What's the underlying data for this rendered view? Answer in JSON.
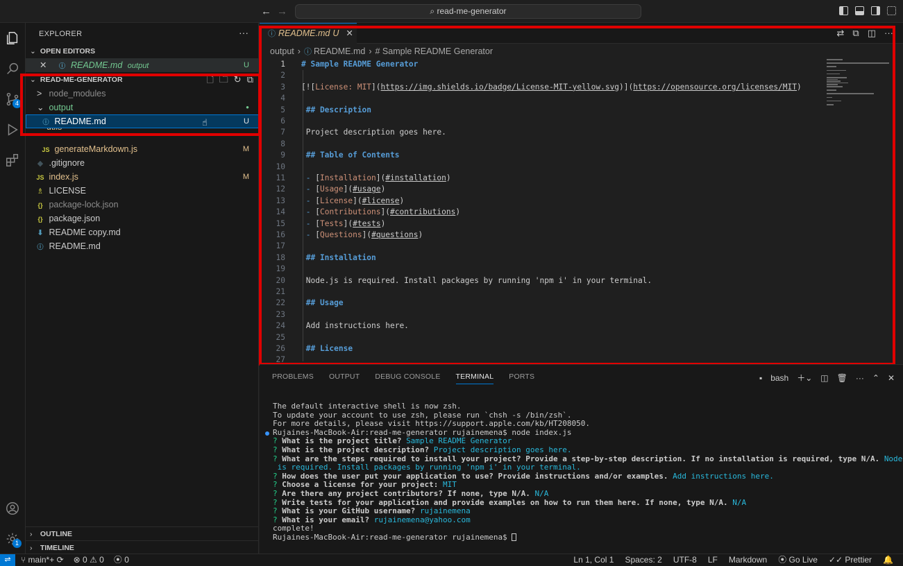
{
  "titlebar": {
    "back_icon": "arrow-left-icon",
    "forward_icon": "arrow-right-icon",
    "search_text": "read-me-generator"
  },
  "activity": {
    "scm_badge": "4",
    "settings_badge": "1"
  },
  "sidebar": {
    "title": "EXPLORER",
    "more": "···",
    "open_editors": {
      "header": "OPEN EDITORS",
      "items": [
        {
          "name": "README.md",
          "folder": "output",
          "status": "U"
        }
      ]
    },
    "project": {
      "header": "READ-ME-GENERATOR",
      "items": [
        {
          "label": "node_modules",
          "kind": "folder",
          "chevron": ">",
          "status": ""
        },
        {
          "label": "output",
          "kind": "folder",
          "chevron": "⌄",
          "status": "●"
        },
        {
          "label": "README.md",
          "kind": "info",
          "status": "U"
        },
        {
          "label": "utils",
          "kind": "folder",
          "status": ""
        },
        {
          "label": "generateMarkdown.js",
          "kind": "js",
          "status": "M"
        },
        {
          "label": ".gitignore",
          "kind": "git",
          "status": ""
        },
        {
          "label": "index.js",
          "kind": "js",
          "status": "M"
        },
        {
          "label": "LICENSE",
          "kind": "license",
          "status": ""
        },
        {
          "label": "package-lock.json",
          "kind": "json",
          "status": ""
        },
        {
          "label": "package.json",
          "kind": "json",
          "status": ""
        },
        {
          "label": "README copy.md",
          "kind": "md",
          "status": ""
        },
        {
          "label": "README.md",
          "kind": "md",
          "status": ""
        }
      ]
    },
    "outline": "OUTLINE",
    "timeline": "TIMELINE"
  },
  "editor": {
    "tab": {
      "label": "README.md",
      "status": "U",
      "close": "✕"
    },
    "breadcrumb": [
      "output",
      "README.md",
      "# Sample README Generator"
    ],
    "lines": [
      {
        "n": "1",
        "parts": [
          {
            "t": "# Sample README Generator",
            "c": "hd"
          }
        ]
      },
      {
        "n": "2",
        "parts": []
      },
      {
        "n": "3",
        "parts": [
          {
            "t": "[![",
            "c": "lt"
          },
          {
            "t": "License: MIT",
            "c": "lk"
          },
          {
            "t": "](",
            "c": "lt"
          },
          {
            "t": "https://img.shields.io/badge/License-MIT-yellow.svg",
            "c": "lu"
          },
          {
            "t": ")](",
            "c": "lt"
          },
          {
            "t": "https://opensource.org/licenses/MIT",
            "c": "lu"
          },
          {
            "t": ")",
            "c": "lt"
          }
        ]
      },
      {
        "n": "4",
        "parts": []
      },
      {
        "n": "5",
        "parts": [
          {
            "t": " ## Description",
            "c": "hd"
          }
        ]
      },
      {
        "n": "6",
        "parts": []
      },
      {
        "n": "7",
        "parts": [
          {
            "t": " Project description goes here.",
            "c": "lt"
          }
        ]
      },
      {
        "n": "8",
        "parts": []
      },
      {
        "n": "9",
        "parts": [
          {
            "t": " ## Table of Contents",
            "c": "hd"
          }
        ]
      },
      {
        "n": "10",
        "parts": []
      },
      {
        "n": "11",
        "parts": [
          {
            "t": " - ",
            "c": "ls"
          },
          {
            "t": "[",
            "c": "lt"
          },
          {
            "t": "Installation",
            "c": "lk"
          },
          {
            "t": "](",
            "c": "lt"
          },
          {
            "t": "#installation",
            "c": "lu"
          },
          {
            "t": ")",
            "c": "lt"
          }
        ]
      },
      {
        "n": "12",
        "parts": [
          {
            "t": " - ",
            "c": "ls"
          },
          {
            "t": "[",
            "c": "lt"
          },
          {
            "t": "Usage",
            "c": "lk"
          },
          {
            "t": "](",
            "c": "lt"
          },
          {
            "t": "#usage",
            "c": "lu"
          },
          {
            "t": ")",
            "c": "lt"
          }
        ]
      },
      {
        "n": "13",
        "parts": [
          {
            "t": " - ",
            "c": "ls"
          },
          {
            "t": "[",
            "c": "lt"
          },
          {
            "t": "License",
            "c": "lk"
          },
          {
            "t": "](",
            "c": "lt"
          },
          {
            "t": "#license",
            "c": "lu"
          },
          {
            "t": ")",
            "c": "lt"
          }
        ]
      },
      {
        "n": "14",
        "parts": [
          {
            "t": " - ",
            "c": "ls"
          },
          {
            "t": "[",
            "c": "lt"
          },
          {
            "t": "Contributions",
            "c": "lk"
          },
          {
            "t": "](",
            "c": "lt"
          },
          {
            "t": "#contributions",
            "c": "lu"
          },
          {
            "t": ")",
            "c": "lt"
          }
        ]
      },
      {
        "n": "15",
        "parts": [
          {
            "t": " - ",
            "c": "ls"
          },
          {
            "t": "[",
            "c": "lt"
          },
          {
            "t": "Tests",
            "c": "lk"
          },
          {
            "t": "](",
            "c": "lt"
          },
          {
            "t": "#tests",
            "c": "lu"
          },
          {
            "t": ")",
            "c": "lt"
          }
        ]
      },
      {
        "n": "16",
        "parts": [
          {
            "t": " - ",
            "c": "ls"
          },
          {
            "t": "[",
            "c": "lt"
          },
          {
            "t": "Questions",
            "c": "lk"
          },
          {
            "t": "](",
            "c": "lt"
          },
          {
            "t": "#questions",
            "c": "lu"
          },
          {
            "t": ")",
            "c": "lt"
          }
        ]
      },
      {
        "n": "17",
        "parts": []
      },
      {
        "n": "18",
        "parts": [
          {
            "t": " ## Installation",
            "c": "hd"
          }
        ]
      },
      {
        "n": "19",
        "parts": []
      },
      {
        "n": "20",
        "parts": [
          {
            "t": " Node.js is required. Install packages by running 'npm i' in your terminal.",
            "c": "lt"
          }
        ]
      },
      {
        "n": "21",
        "parts": []
      },
      {
        "n": "22",
        "parts": [
          {
            "t": " ## Usage",
            "c": "hd"
          }
        ]
      },
      {
        "n": "23",
        "parts": []
      },
      {
        "n": "24",
        "parts": [
          {
            "t": " Add instructions here.",
            "c": "lt"
          }
        ]
      },
      {
        "n": "25",
        "parts": []
      },
      {
        "n": "26",
        "parts": [
          {
            "t": " ## License",
            "c": "hd"
          }
        ]
      },
      {
        "n": "27",
        "parts": []
      }
    ]
  },
  "panel": {
    "tabs": [
      "PROBLEMS",
      "OUTPUT",
      "DEBUG CONSOLE",
      "TERMINAL",
      "PORTS"
    ],
    "active_tab": "TERMINAL",
    "shell": "bash",
    "terminal": [
      {
        "type": "plain",
        "text": "The default interactive shell is now zsh."
      },
      {
        "type": "plain",
        "text": "To update your account to use zsh, please run `chsh -s /bin/zsh`."
      },
      {
        "type": "plain",
        "text": "For more details, please visit https://support.apple.com/kb/HT208050."
      },
      {
        "type": "prompt",
        "text": "Rujaines-MacBook-Air:read-me-generator rujainemena$ node index.js"
      },
      {
        "type": "qa",
        "q": "What is the project title?",
        "a": "Sample README Generator"
      },
      {
        "type": "qa",
        "q": "What is the project description?",
        "a": "Project description goes here."
      },
      {
        "type": "qa",
        "q": "What are the steps required to install your project? Provide a step-by-step description. If no installation is required, type N/A.",
        "a": "Node.js"
      },
      {
        "type": "cont",
        "text": " is required. Install packages by running 'npm i' in your terminal."
      },
      {
        "type": "qa",
        "q": "How does the user put your application to use? Provide instructions and/or examples.",
        "a": "Add instructions here."
      },
      {
        "type": "qa",
        "q": "Choose a license for your project:",
        "a": "MIT"
      },
      {
        "type": "qa",
        "q": "Are there any project contributors? If none, type N/A.",
        "a": "N/A"
      },
      {
        "type": "qa",
        "q": "Write tests for your application and provide examples on how to run them here. If none, type N/A.",
        "a": "N/A"
      },
      {
        "type": "qa",
        "q": "What is your GitHub username?",
        "a": "rujainemena"
      },
      {
        "type": "qa",
        "q": "What is your email?",
        "a": "rujainemena@yahoo.com"
      },
      {
        "type": "plain",
        "text": "complete!"
      },
      {
        "type": "final",
        "text": "Rujaines-MacBook-Air:read-me-generator rujainemena$ "
      }
    ]
  },
  "status": {
    "branch": "main*+",
    "errors": "0",
    "warnings": "0",
    "ports": "0",
    "position": "Ln 1, Col 1",
    "spaces": "Spaces: 2",
    "encoding": "UTF-8",
    "eol": "LF",
    "language": "Markdown",
    "golive": "Go Live",
    "prettier": "Prettier"
  },
  "colors": {
    "accent": "#0078d4",
    "highlight_box": "#e00000",
    "untracked": "#73c991",
    "modified": "#e2c08d"
  }
}
